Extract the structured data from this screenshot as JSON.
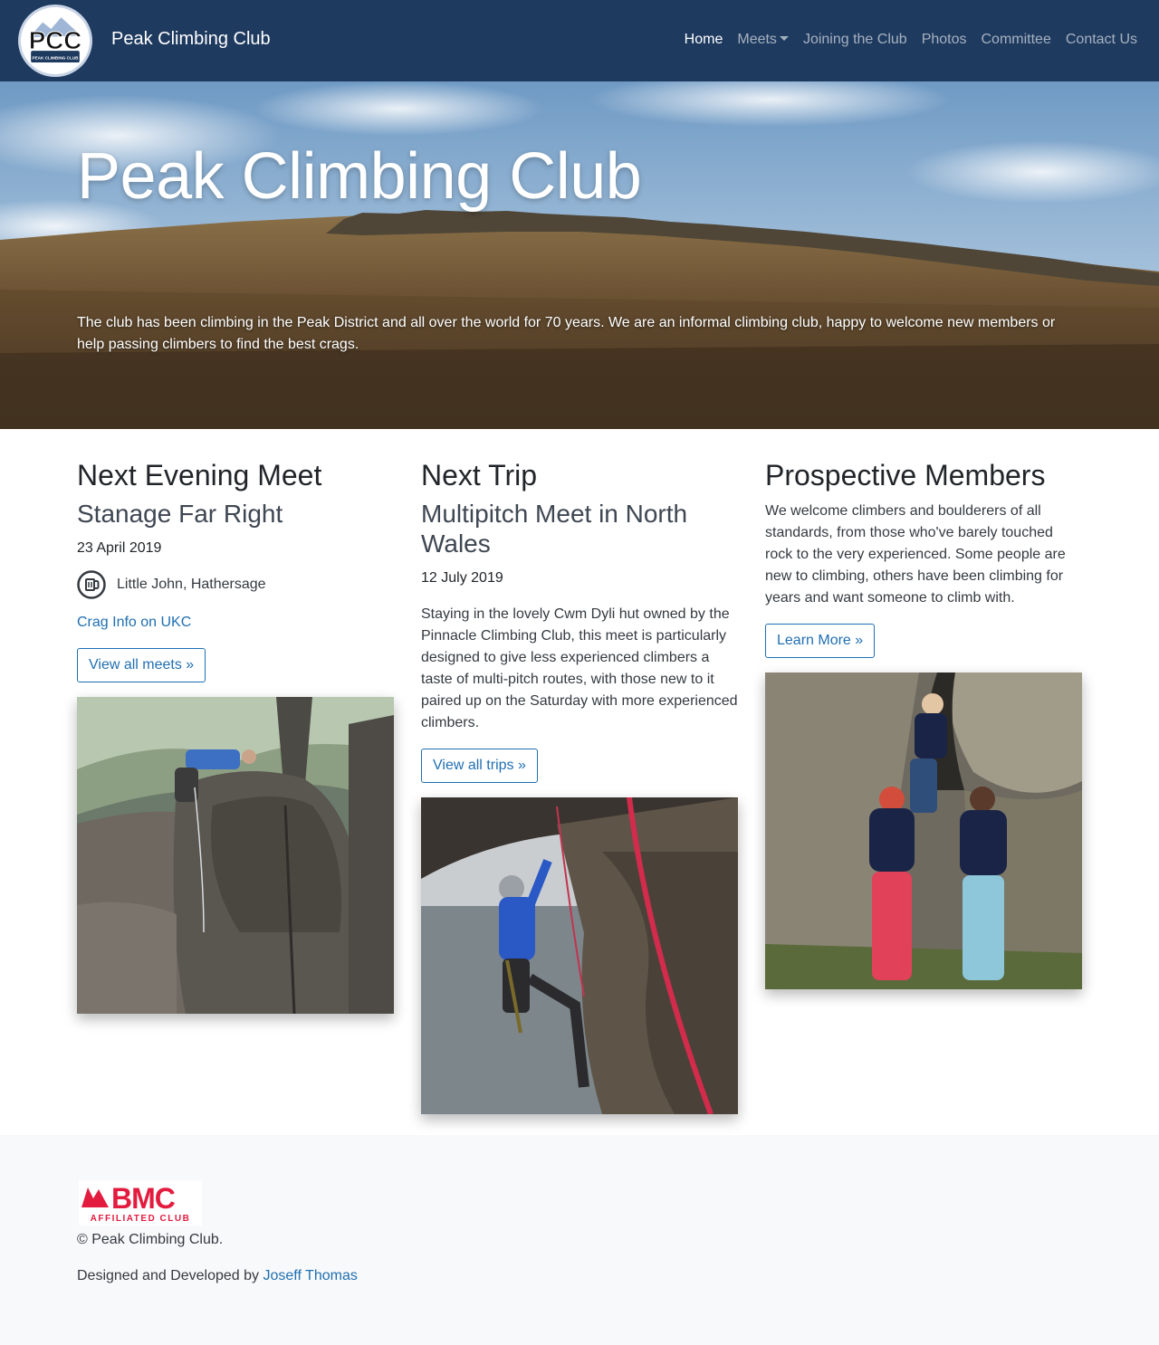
{
  "brand": {
    "title": "Peak Climbing Club",
    "logo_text": "PCC",
    "logo_subtext": "PEAK CLIMBING CLUB"
  },
  "nav": {
    "home": "Home",
    "meets": "Meets",
    "joining": "Joining the Club",
    "photos": "Photos",
    "committee": "Committee",
    "contact": "Contact Us"
  },
  "hero": {
    "title": "Peak Climbing Club",
    "text": "The club has been climbing in the Peak District and all over the world for 70 years. We are an informal climbing club, happy to welcome new members or help passing climbers to find the best crags."
  },
  "evening_meet": {
    "heading": "Next Evening Meet",
    "name": "Stanage Far Right",
    "date": "23 April 2019",
    "venue_icon": "pint-glass-icon",
    "venue": "Little John, Hathersage",
    "crag_link": "Crag Info on UKC",
    "button": "View all meets »"
  },
  "next_trip": {
    "heading": "Next Trip",
    "name": "Multipitch Meet in North Wales",
    "date": "12 July 2019",
    "description": "Staying in the lovely Cwm Dyli hut owned by the Pinnacle Climbing Club, this meet is particularly designed to give less experienced climbers a taste of multi-pitch routes, with those new to it paired up on the Saturday with more experienced climbers.",
    "button": "View all trips »"
  },
  "prospective": {
    "heading": "Prospective Members",
    "description": "We welcome climbers and boulderers of all standards, from those who've barely touched rock to the very experienced. Some people are new to climbing, others have been climbing for years and want someone to climb with.",
    "button": "Learn More »"
  },
  "footer": {
    "bmc_logo_text": "BMC",
    "bmc_logo_subtext": "AFFILIATED CLUB",
    "copyright": "© Peak Climbing Club.",
    "credit_prefix": "Designed and Developed by ",
    "credit_name": "Joseff Thomas"
  },
  "colors": {
    "navbar": "#1e3a5f",
    "link": "#1f6fb2",
    "footer_bg": "#f8f9fa",
    "bmc_red": "#e31b3f"
  }
}
